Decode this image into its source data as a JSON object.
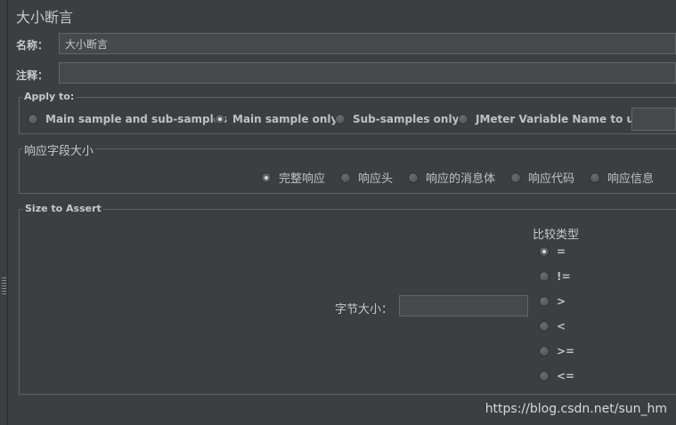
{
  "title": "大小断言",
  "name_field": {
    "label": "名称：",
    "value": "大小断言"
  },
  "comment_field": {
    "label": "注释：",
    "value": ""
  },
  "apply_to": {
    "legend": "Apply to:",
    "options": [
      {
        "label": "Main sample and sub-samples",
        "checked": false
      },
      {
        "label": "Main sample only",
        "checked": true
      },
      {
        "label": "Sub-samples only",
        "checked": false
      },
      {
        "label": "JMeter Variable Name to use",
        "checked": false
      }
    ],
    "variable_value": ""
  },
  "response_field": {
    "legend": "响应字段大小",
    "options": [
      {
        "label": "完整响应",
        "checked": true
      },
      {
        "label": "响应头",
        "checked": false
      },
      {
        "label": "响应的消息体",
        "checked": false
      },
      {
        "label": "响应代码",
        "checked": false
      },
      {
        "label": "响应信息",
        "checked": false
      }
    ]
  },
  "size_to_assert": {
    "legend": "Size to Assert",
    "byte_size_label": "字节大小：",
    "byte_size_value": "",
    "comparison_label": "比较类型",
    "comparisons": [
      {
        "label": "=",
        "checked": true
      },
      {
        "label": "!=",
        "checked": false
      },
      {
        "label": ">",
        "checked": false
      },
      {
        "label": "<",
        "checked": false
      },
      {
        "label": ">=",
        "checked": false
      },
      {
        "label": "<=",
        "checked": false
      }
    ]
  },
  "watermark": "https://blog.csdn.net/sun_hm"
}
